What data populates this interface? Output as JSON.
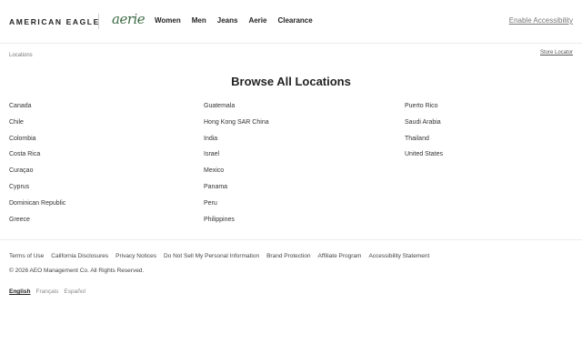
{
  "header": {
    "brand_ae": "AMERICAN EAGLE",
    "brand_aerie": "aerie",
    "nav": [
      "Women",
      "Men",
      "Jeans",
      "Aerie",
      "Clearance"
    ],
    "accessibility_label": "Enable Accessibility"
  },
  "breadcrumb": "Locations",
  "store_locator": "Store Locator",
  "page_title": "Browse All Locations",
  "locations": {
    "col1": [
      "Canada",
      "Chile",
      "Colombia",
      "Costa Rica",
      "Curaçao",
      "Cyprus",
      "Dominican Republic",
      "Greece"
    ],
    "col2": [
      "Guatemala",
      "Hong Kong SAR China",
      "India",
      "Israel",
      "Mexico",
      "Panama",
      "Peru",
      "Philippines"
    ],
    "col3": [
      "Puerto Rico",
      "Saudi Arabia",
      "Thailand",
      "United States"
    ]
  },
  "footer": {
    "links": [
      "Terms of Use",
      "California Disclosures",
      "Privacy Notices",
      "Do Not Sell My Personal Information",
      "Brand Protection",
      "Affiliate Program",
      "Accessibility Statement"
    ],
    "copyright": "© 2026 AEO Management Co. All Rights Reserved.",
    "languages": [
      "English",
      "Français",
      "Español"
    ],
    "active_language": "English"
  },
  "colors": {
    "aerie_brand": "#3d6b45",
    "text": "#222222",
    "muted": "#777777"
  }
}
